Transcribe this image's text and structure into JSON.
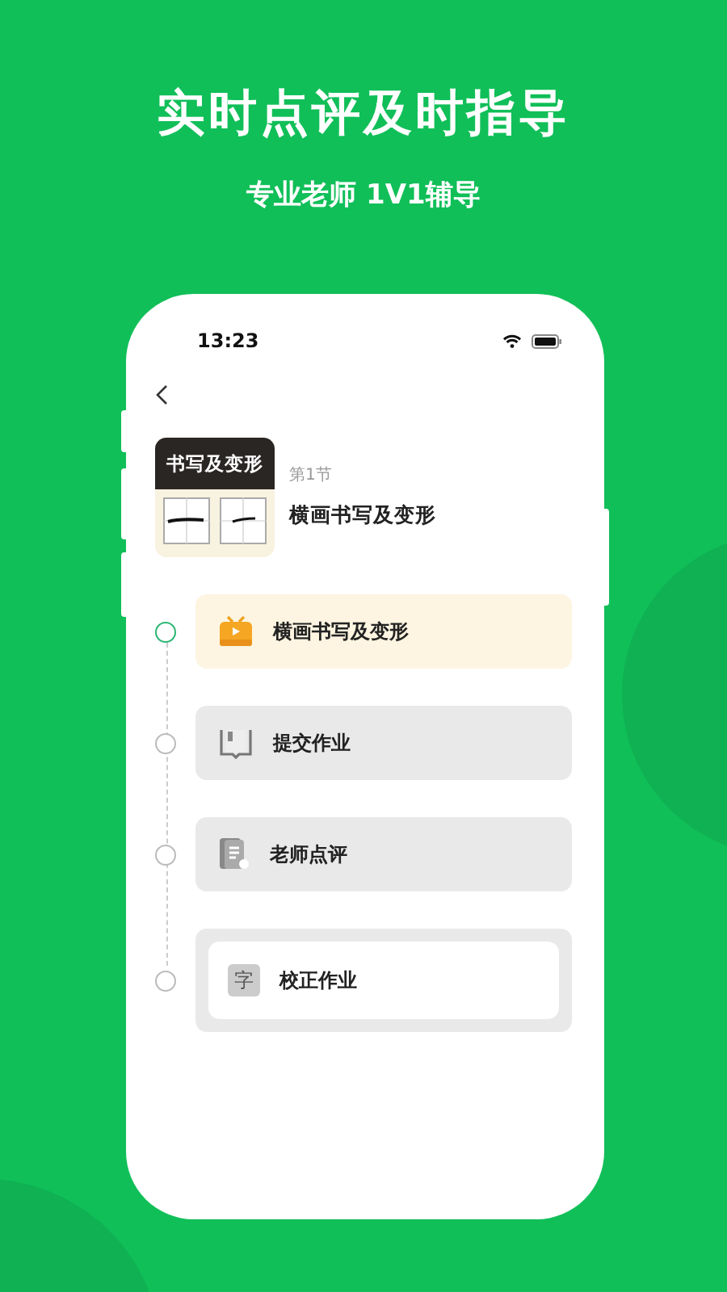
{
  "headline": "实时点评及时指导",
  "subheadline": "专业老师 1V1辅导",
  "status_bar": {
    "time": "13:23"
  },
  "lesson": {
    "thumbnail_title": "书写及变形",
    "section": "第1节",
    "title": "横画书写及变形"
  },
  "steps": [
    {
      "kind": "video",
      "label": "横画书写及变形",
      "selected": true
    },
    {
      "kind": "submit",
      "label": "提交作业",
      "selected": false
    },
    {
      "kind": "review",
      "label": "老师点评",
      "selected": false
    },
    {
      "kind": "correct",
      "label": "校正作业",
      "selected": false,
      "icon_text": "字"
    }
  ]
}
